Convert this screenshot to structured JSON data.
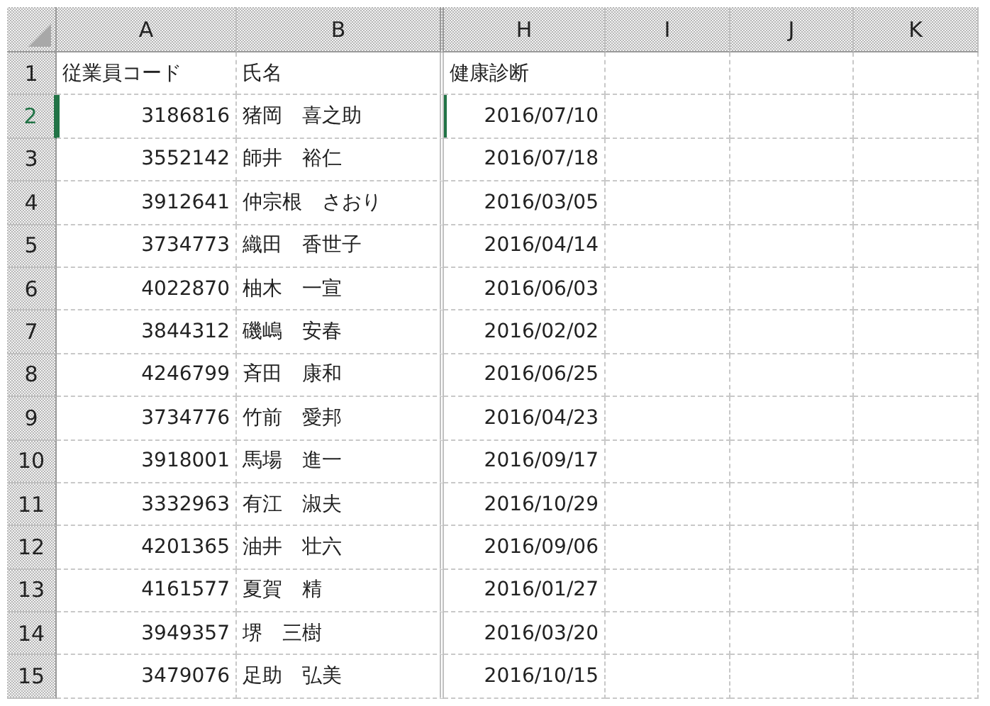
{
  "columns": [
    "A",
    "B",
    "H",
    "I",
    "J",
    "K"
  ],
  "rows": [
    {
      "number": "1",
      "kind": "header",
      "selected": false,
      "cells": [
        "従業員コード",
        "氏名",
        "健康診断"
      ]
    },
    {
      "number": "2",
      "kind": "data",
      "selected": true,
      "cells": [
        "3186816",
        "猪岡　喜之助",
        "2016/07/10"
      ]
    },
    {
      "number": "3",
      "kind": "data",
      "selected": false,
      "cells": [
        "3552142",
        "師井　裕仁",
        "2016/07/18"
      ]
    },
    {
      "number": "4",
      "kind": "data",
      "selected": false,
      "cells": [
        "3912641",
        "仲宗根　さおり",
        "2016/03/05"
      ]
    },
    {
      "number": "5",
      "kind": "data",
      "selected": false,
      "cells": [
        "3734773",
        "織田　香世子",
        "2016/04/14"
      ]
    },
    {
      "number": "6",
      "kind": "data",
      "selected": false,
      "cells": [
        "4022870",
        "柚木　一宣",
        "2016/06/03"
      ]
    },
    {
      "number": "7",
      "kind": "data",
      "selected": false,
      "cells": [
        "3844312",
        "磯嶋　安春",
        "2016/02/02"
      ]
    },
    {
      "number": "8",
      "kind": "data",
      "selected": false,
      "cells": [
        "4246799",
        "斉田　康和",
        "2016/06/25"
      ]
    },
    {
      "number": "9",
      "kind": "data",
      "selected": false,
      "cells": [
        "3734776",
        "竹前　愛邦",
        "2016/04/23"
      ]
    },
    {
      "number": "10",
      "kind": "data",
      "selected": false,
      "cells": [
        "3918001",
        "馬場　進一",
        "2016/09/17"
      ]
    },
    {
      "number": "11",
      "kind": "data",
      "selected": false,
      "cells": [
        "3332963",
        "有江　淑夫",
        "2016/10/29"
      ]
    },
    {
      "number": "12",
      "kind": "data",
      "selected": false,
      "cells": [
        "4201365",
        "油井　壮六",
        "2016/09/06"
      ]
    },
    {
      "number": "13",
      "kind": "data",
      "selected": false,
      "cells": [
        "4161577",
        "夏賀　精",
        "2016/01/27"
      ]
    },
    {
      "number": "14",
      "kind": "data",
      "selected": false,
      "cells": [
        "3949357",
        "堺　三樹",
        "2016/03/20"
      ]
    },
    {
      "number": "15",
      "kind": "data",
      "selected": false,
      "cells": [
        "3479076",
        "足助　弘美",
        "2016/10/15"
      ]
    }
  ]
}
